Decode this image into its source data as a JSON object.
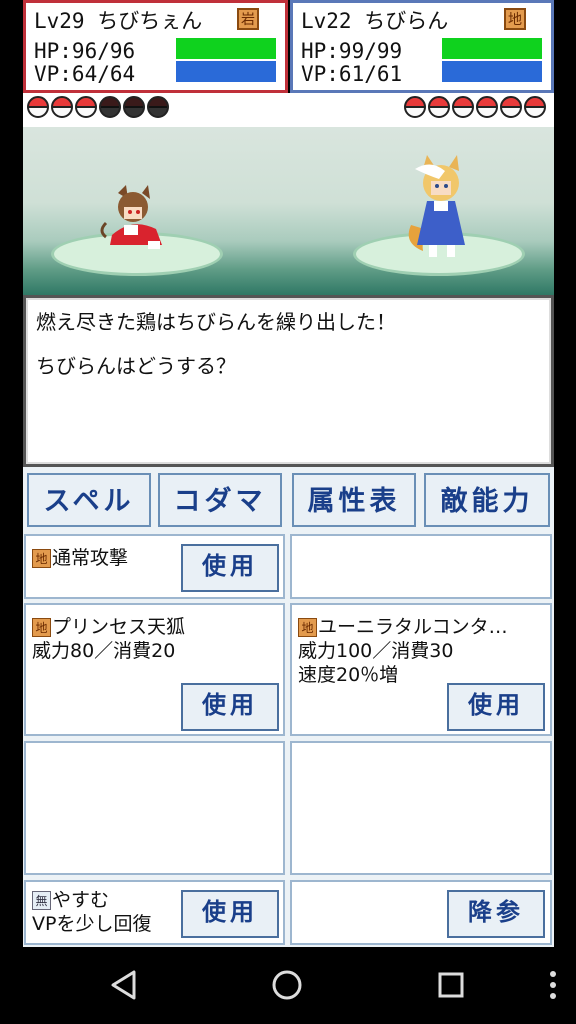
{
  "player": {
    "level_name": "Lv29 ちびちぇん",
    "hp": "HP:96/96",
    "vp": "VP:64/64",
    "element": "岩",
    "hp_fill": 1.0,
    "vp_fill": 1.0
  },
  "enemy": {
    "level_name": "Lv22 ちびらん",
    "hp": "HP:99/99",
    "vp": "VP:61/61",
    "element": "地",
    "hp_fill": 1.0,
    "vp_fill": 1.0
  },
  "party": {
    "player_balls": [
      "on",
      "on",
      "on",
      "off",
      "off",
      "off"
    ],
    "enemy_balls": [
      "on",
      "on",
      "on",
      "on",
      "on",
      "on"
    ]
  },
  "message": {
    "line1": "燃え尽きた鶏はちびらんを繰り出した！",
    "line2": "ちびらんはどうする？"
  },
  "tabs": {
    "spell": "スペル",
    "kodama": "コダマ",
    "attribute_table": "属性表",
    "enemy_ability": "敵能力"
  },
  "skills": {
    "normal_attack": {
      "element": "地",
      "name": "通常攻撃"
    },
    "princess_tenko": {
      "element": "地",
      "name": "プリンセス天狐",
      "stats": "威力80／消費20"
    },
    "unilateral": {
      "element": "地",
      "name": "ユーニラタルコンタ…",
      "stats": "威力100／消費30",
      "effect": "速度20％増"
    },
    "rest": {
      "element": "無",
      "name": "やすむ",
      "desc": "VPを少し回復"
    }
  },
  "buttons": {
    "use": "使用",
    "surrender": "降参"
  },
  "colors": {
    "hp_bar": "#0fd21e",
    "vp_bar": "#2a6ad8",
    "button_text": "#1a3f8a",
    "player_border": "#c0303a",
    "enemy_border": "#5a78b8"
  }
}
